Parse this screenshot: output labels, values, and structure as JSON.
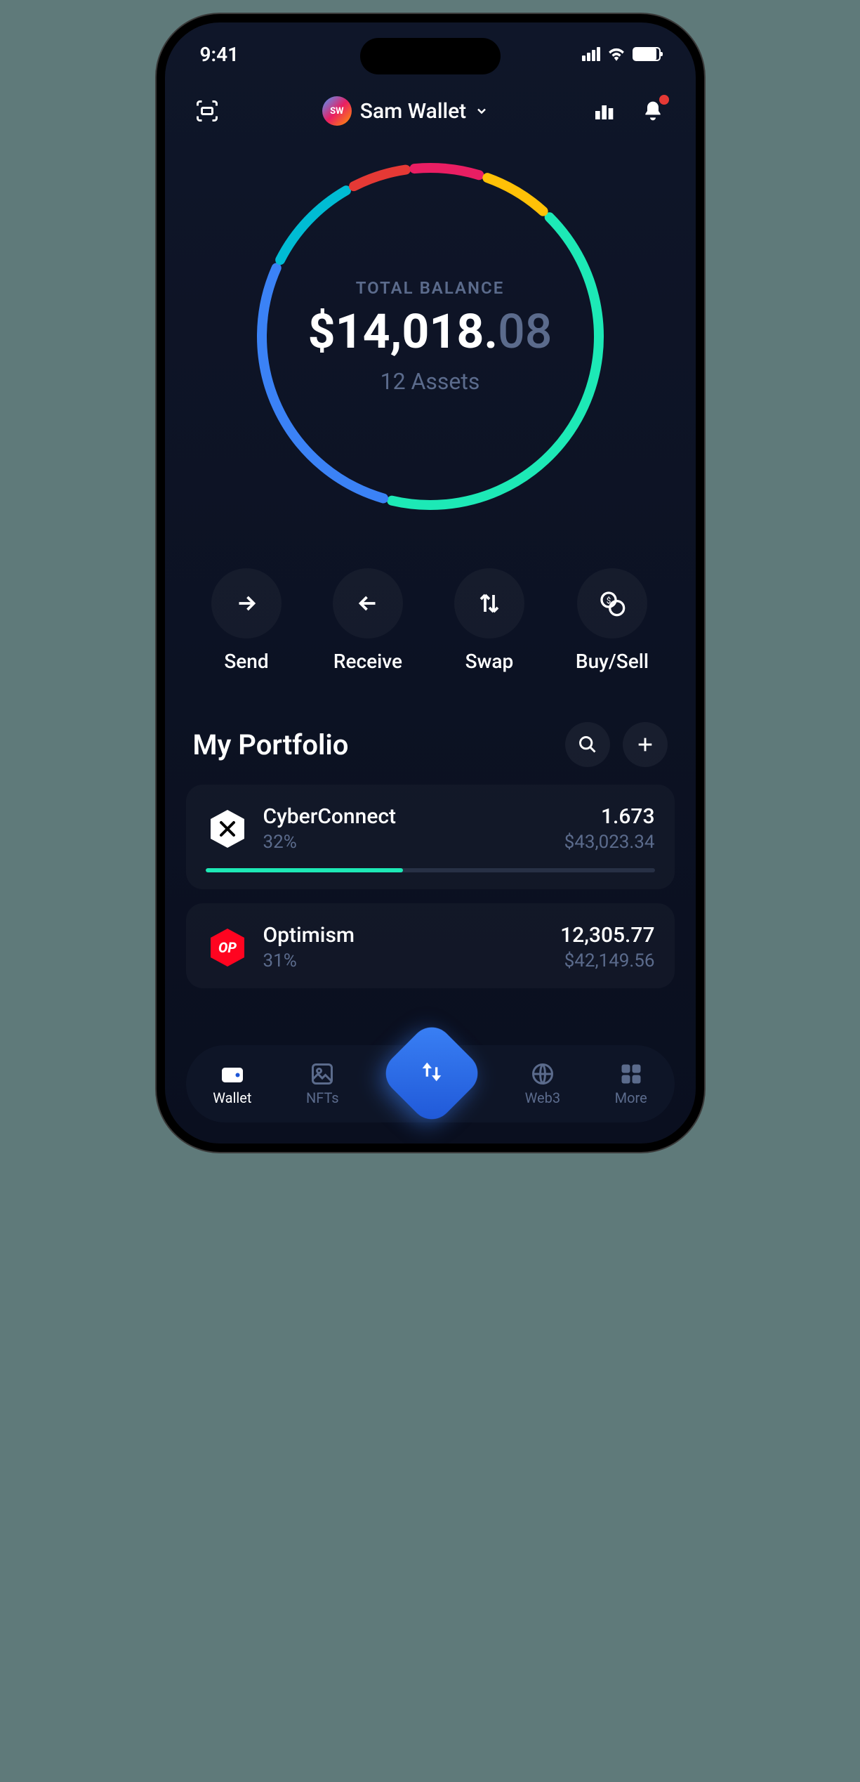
{
  "status_bar": {
    "time": "9:41"
  },
  "header": {
    "wallet_initials": "SW",
    "wallet_name": "Sam Wallet"
  },
  "balance": {
    "label": "TOTAL BALANCE",
    "currency": "$",
    "major": "14,018.",
    "minor": "08",
    "asset_count": "12 Assets"
  },
  "actions": {
    "send": "Send",
    "receive": "Receive",
    "swap": "Swap",
    "buysell": "Buy/Sell"
  },
  "portfolio": {
    "title": "My Portfolio",
    "items": [
      {
        "name": "CyberConnect",
        "pct": "32%",
        "amount": "1.673",
        "usd": "$43,023.34",
        "progress": 44,
        "color": "#fff",
        "symbol": "✕"
      },
      {
        "name": "Optimism",
        "pct": "31%",
        "amount": "12,305.77",
        "usd": "$42,149.56",
        "progress": 0,
        "color": "#FF0420",
        "symbol": "OP"
      }
    ]
  },
  "nav": {
    "wallet": "Wallet",
    "nfts": "NFTs",
    "web3": "Web3",
    "more": "More"
  },
  "chart_data": {
    "type": "pie",
    "title": "Portfolio allocation",
    "series": [
      {
        "name": "Green segment",
        "value": 42,
        "color": "#1DE9B6"
      },
      {
        "name": "Blue segment",
        "value": 28,
        "color": "#3B82F6"
      },
      {
        "name": "Teal segment",
        "value": 10,
        "color": "#00BCD4"
      },
      {
        "name": "Red segment",
        "value": 6,
        "color": "#E53935"
      },
      {
        "name": "Magenta segment",
        "value": 7,
        "color": "#E91E63"
      },
      {
        "name": "Yellow segment",
        "value": 7,
        "color": "#FFC107"
      }
    ]
  }
}
